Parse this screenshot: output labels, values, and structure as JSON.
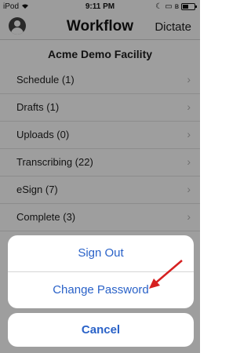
{
  "status_bar": {
    "carrier": "iPod",
    "time": "9:11 PM",
    "icons": [
      "wifi-icon",
      "moon-icon",
      "screen-lock-icon",
      "bluetooth-icon",
      "battery-icon"
    ]
  },
  "nav": {
    "title": "Workflow",
    "right_button": "Dictate",
    "left_icon": "profile-icon"
  },
  "facility": "Acme Demo Facility",
  "menu_items": [
    {
      "label": "Schedule (1)"
    },
    {
      "label": "Drafts (1)"
    },
    {
      "label": "Uploads (0)"
    },
    {
      "label": "Transcribing (22)"
    },
    {
      "label": "eSign (7)"
    },
    {
      "label": "Complete (3)"
    }
  ],
  "action_sheet": {
    "sign_out": "Sign Out",
    "change_password": "Change Password",
    "cancel": "Cancel"
  },
  "colors": {
    "accent": "#2a62c8",
    "annotation": "#d62020",
    "nav_bg": "#d9d9d9"
  },
  "annotation": "arrow-icon pointing at Change Password",
  "battery_level": 0.5
}
